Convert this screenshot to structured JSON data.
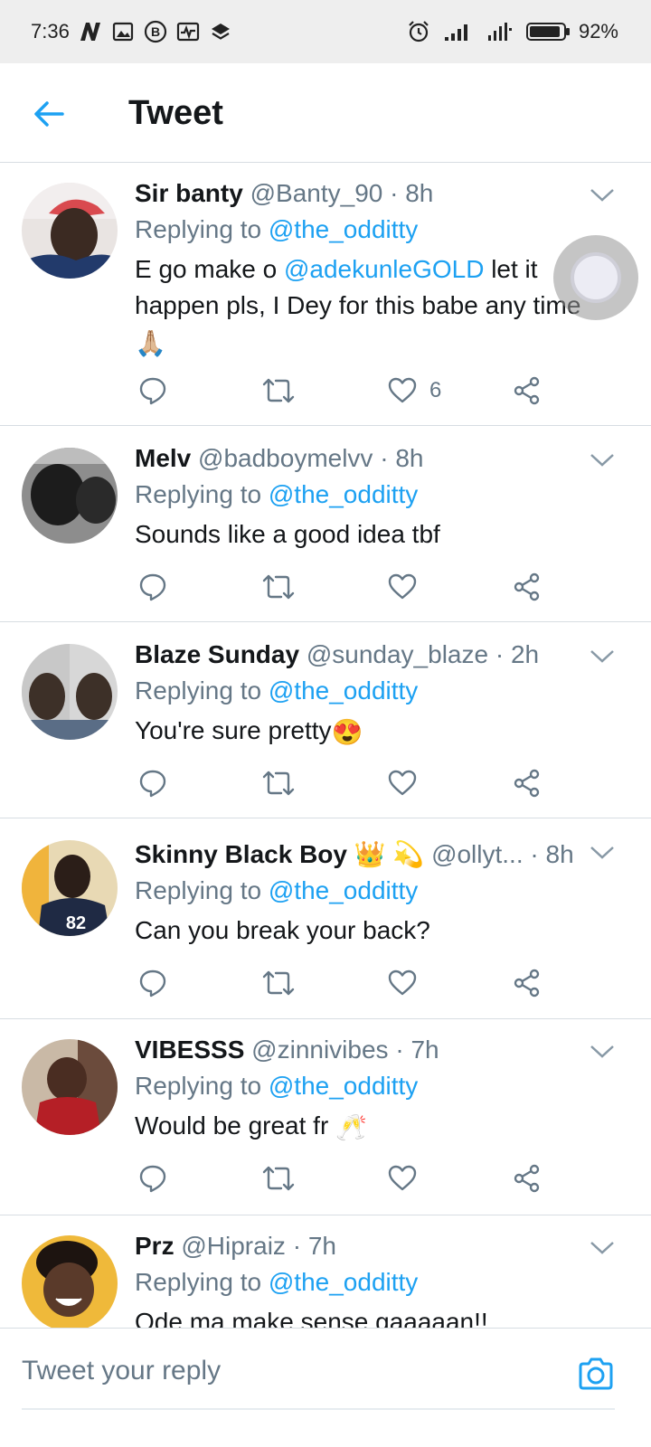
{
  "status_bar": {
    "time": "7:36",
    "battery": "92%",
    "battery_level": 0.92
  },
  "header": {
    "title": "Tweet"
  },
  "tweets": [
    {
      "name": "Sir banty",
      "handle": "@Banty_90",
      "sep": "·",
      "time": "8h",
      "replying_label": "Replying to",
      "replying_to": "@the_odditty",
      "text_before": "E go make o ",
      "mention": "@adekunleGOLD",
      "text_after": " let it happen pls, I Dey for this babe any time",
      "emoji": "🙏🏼",
      "likes": "6"
    },
    {
      "name": "Melv",
      "handle": "@badboymelvv",
      "sep": "·",
      "time": "8h",
      "replying_label": "Replying to",
      "replying_to": "@the_odditty",
      "text": "Sounds like a good idea tbf"
    },
    {
      "name": "Blaze Sunday",
      "handle": "@sunday_blaze",
      "sep": "·",
      "time": "2h",
      "replying_label": "Replying to",
      "replying_to": "@the_odditty",
      "text": "You're sure pretty",
      "emoji": "😍"
    },
    {
      "name": "Skinny Black Boy",
      "name_emoji": "👑 💫",
      "handle": "@ollyt...",
      "sep": "·",
      "time": "8h",
      "replying_label": "Replying to",
      "replying_to": "@the_odditty",
      "text": "Can you break your back?"
    },
    {
      "name": "VIBESSS",
      "handle": "@zinnivibes",
      "sep": "·",
      "time": "7h",
      "replying_label": "Replying to",
      "replying_to": "@the_odditty",
      "text": "Would be great fr",
      "emoji": "🥂"
    },
    {
      "name": "Prz",
      "handle": "@Hipraiz",
      "sep": "·",
      "time": "7h",
      "replying_label": "Replying to",
      "replying_to": "@the_odditty",
      "text": "Ode ma make sense gaaaaan!!"
    }
  ],
  "reply_bar": {
    "placeholder": "Tweet your reply"
  },
  "icons": {
    "back": "arrow-left-icon",
    "reply": "speech-bubble-icon",
    "retweet": "retweet-icon",
    "like": "heart-icon",
    "share": "share-icon",
    "caret": "chevron-down-icon",
    "camera": "camera-icon"
  },
  "colors": {
    "accent": "#1da1f2",
    "secondary_text": "#657786",
    "divider": "#d7dde2"
  }
}
